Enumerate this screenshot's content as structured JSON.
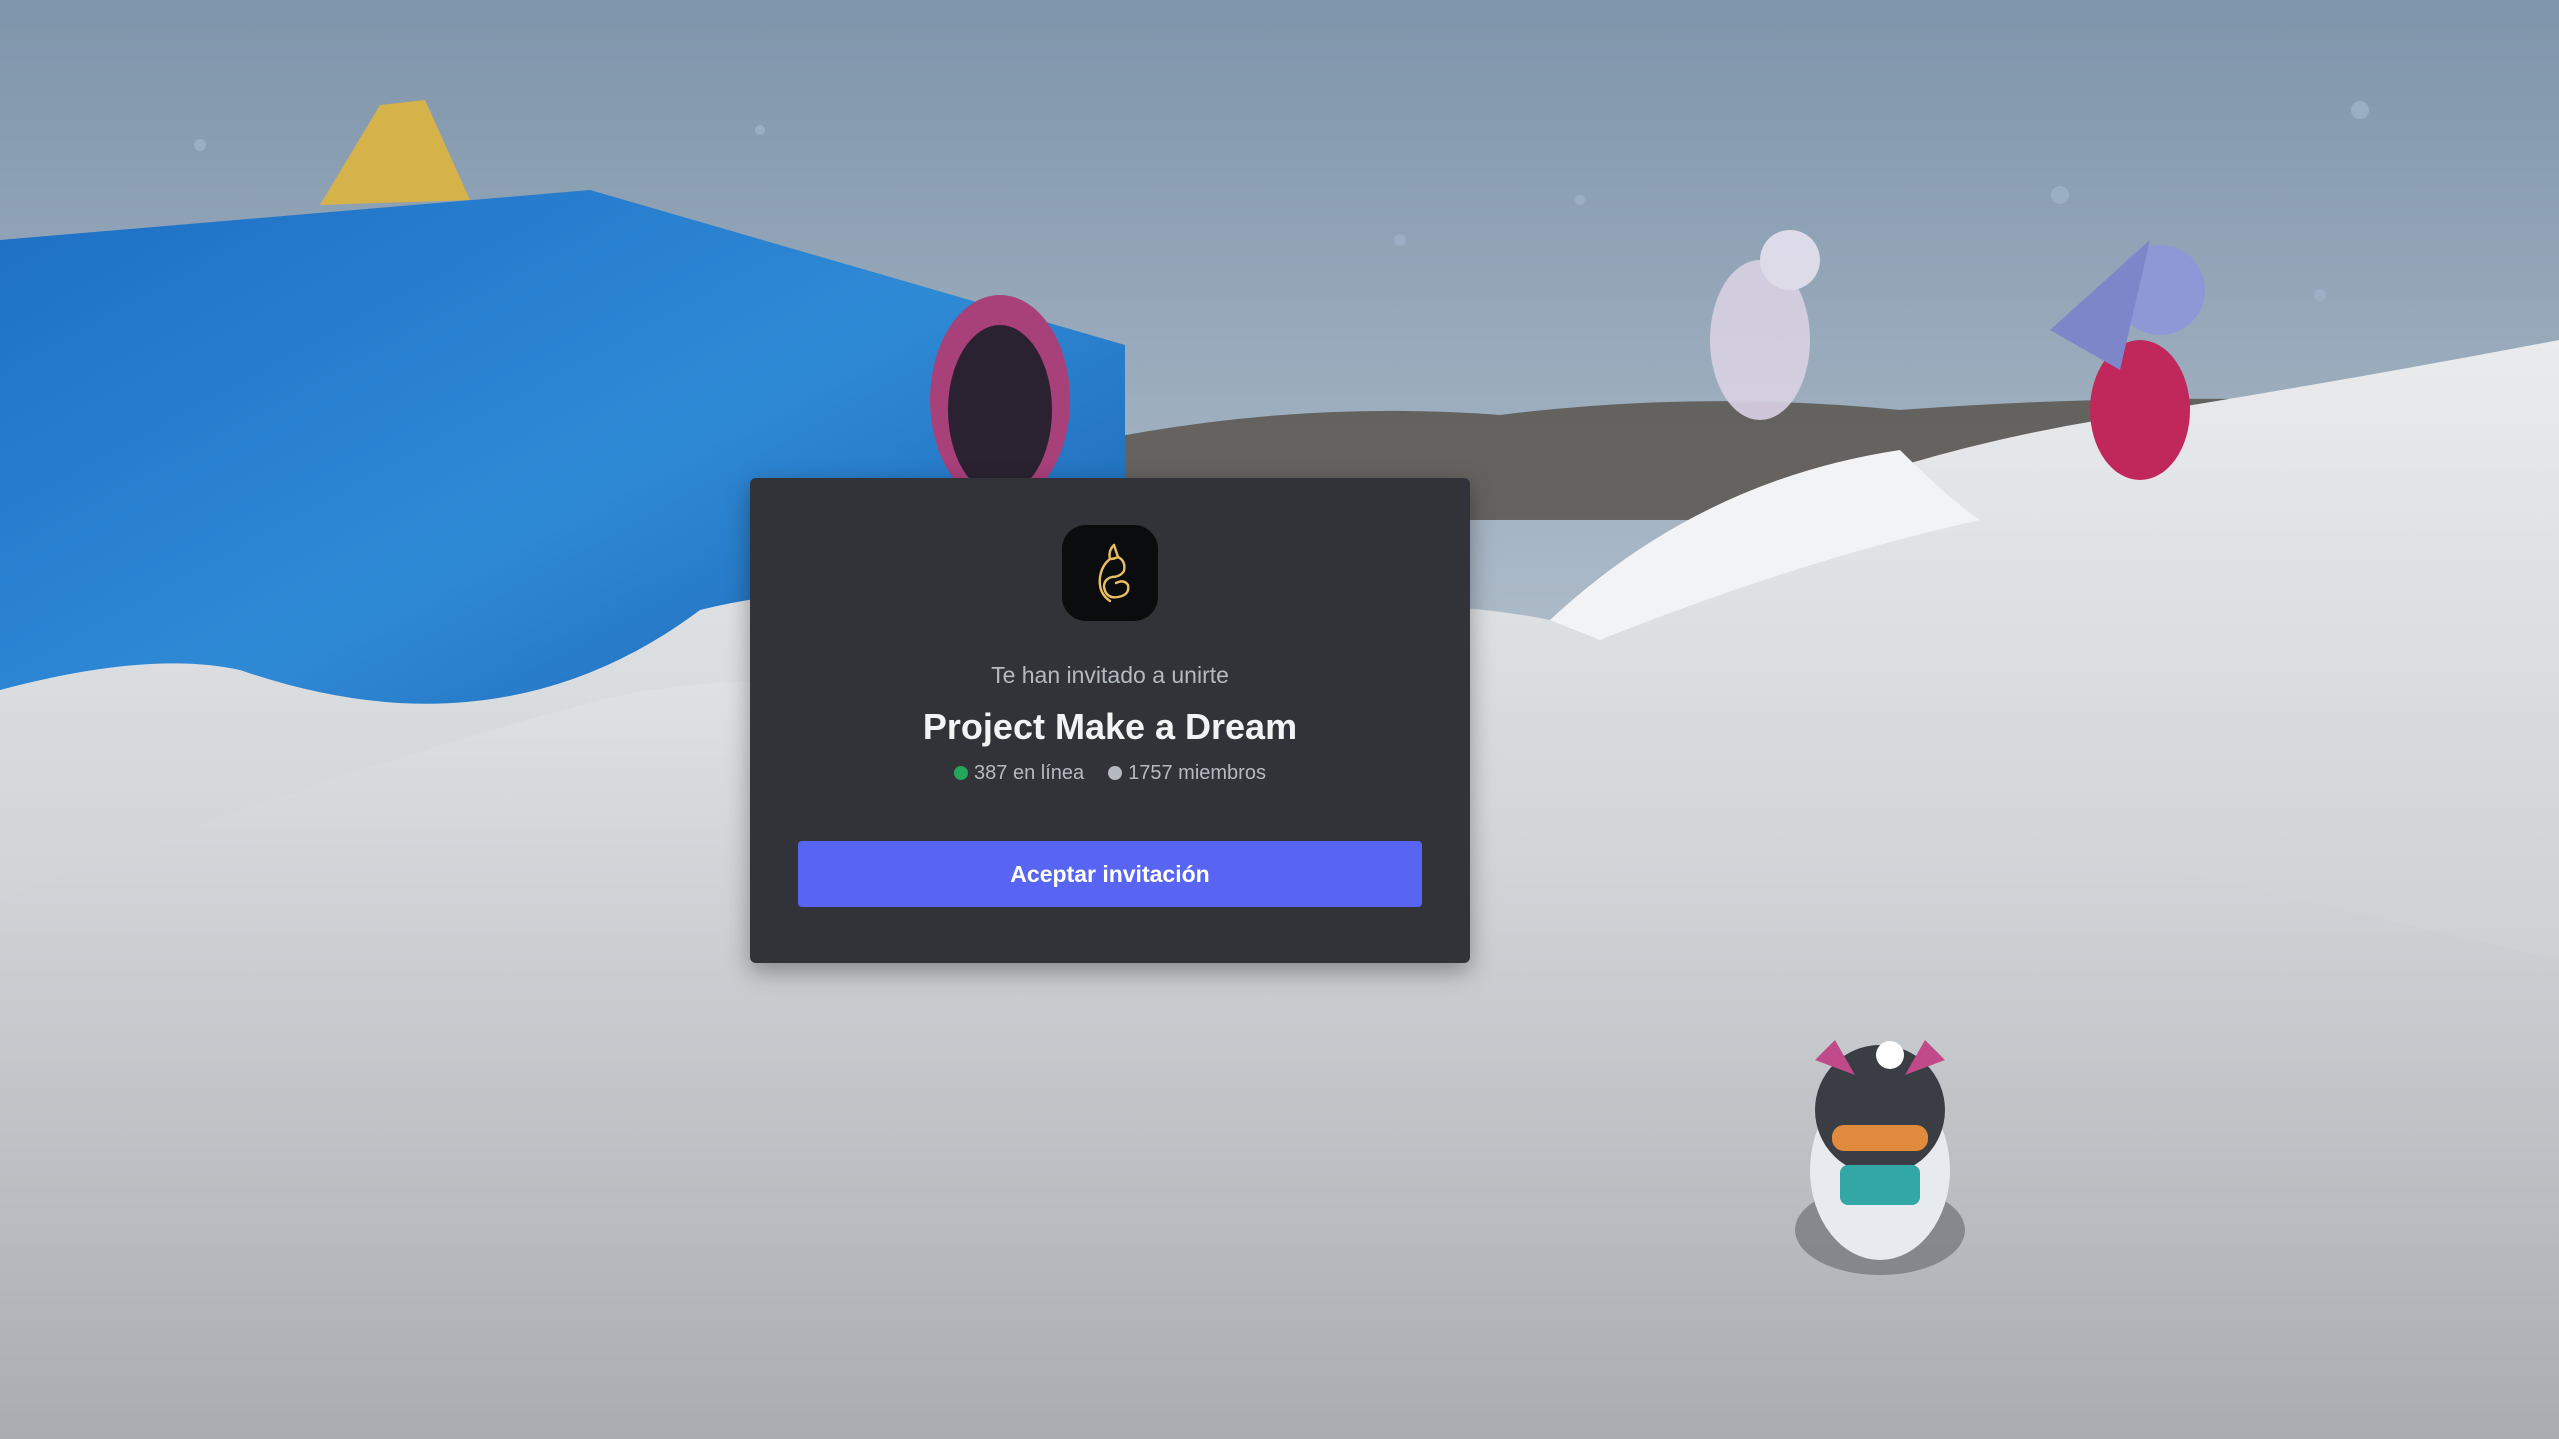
{
  "invite": {
    "invited_text": "Te han invitado a unirte",
    "server_name": "Project Make a Dream",
    "online_count": "387 en línea",
    "member_count": "1757 miembros",
    "accept_label": "Aceptar invitación",
    "server_icon": "fox-logo-icon"
  },
  "colors": {
    "modal_background": "#313338",
    "accent": "#5865f2",
    "online_status": "#23a55a",
    "members_status": "#b5bac1",
    "fox_logo": "#e8c063"
  }
}
